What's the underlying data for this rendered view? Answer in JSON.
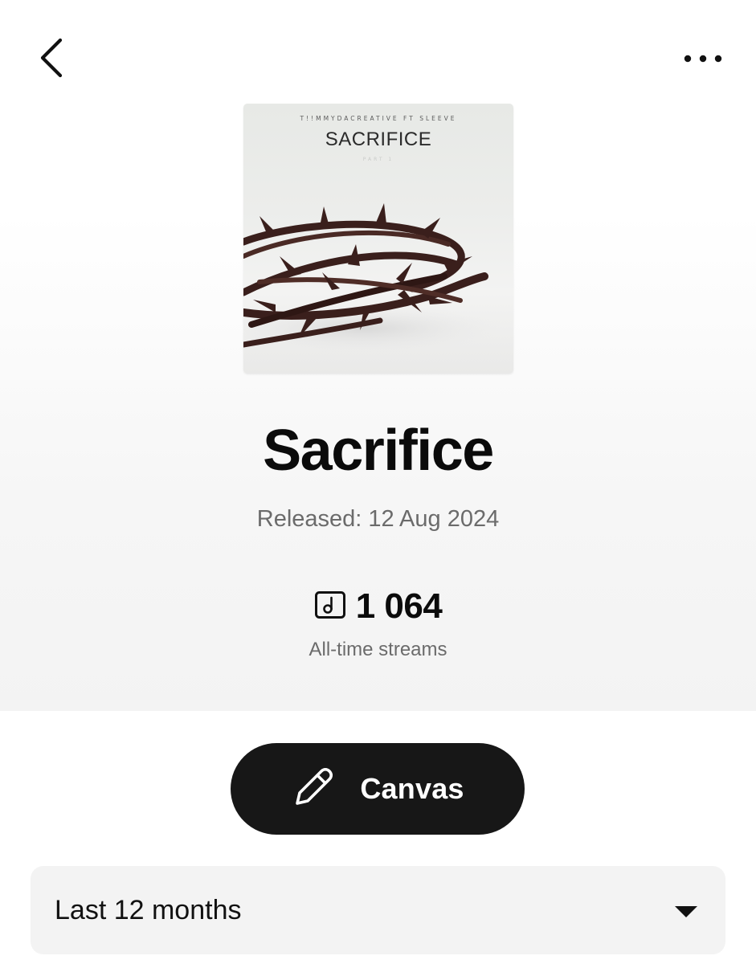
{
  "header": {
    "back_icon": "chevron-left-icon",
    "more_icon": "more-horizontal-icon"
  },
  "cover": {
    "artist_line": "T!!MMYDACREATIVE FT SLEEVE",
    "title": "SACRIFICE",
    "subtitle": "PART 1"
  },
  "track": {
    "title": "Sacrifice",
    "released_label": "Released:",
    "released_date": "12 Aug 2024",
    "stream_icon": "music-note-icon",
    "streams_count": "1 064",
    "streams_label": "All-time streams"
  },
  "actions": {
    "canvas_icon": "pencil-icon",
    "canvas_label": "Canvas"
  },
  "period_select": {
    "selected": "Last 12 months",
    "caret_icon": "caret-down-icon"
  },
  "colors": {
    "button_bg": "#171717",
    "secondary_text": "#6b6b6b",
    "select_bg": "#f3f3f3"
  }
}
